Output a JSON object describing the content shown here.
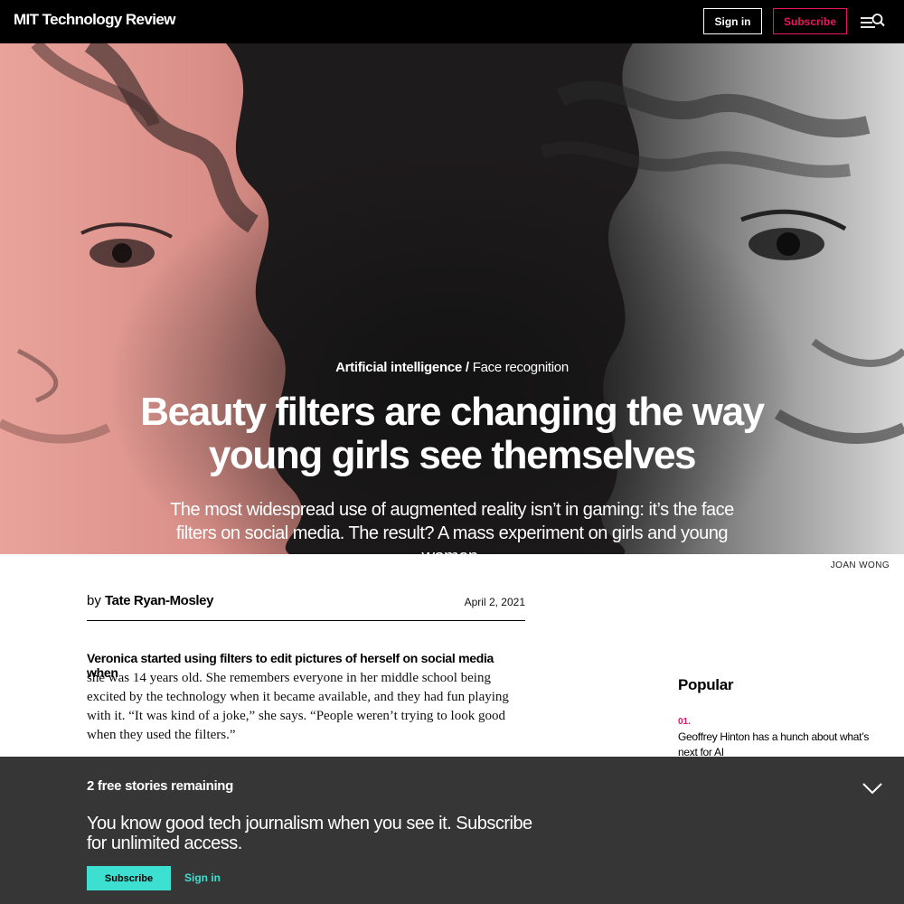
{
  "header": {
    "logo": "MIT Technology Review",
    "signin_label": "Sign in",
    "subscribe_label": "Subscribe",
    "menu_icon": "menu-search-icon"
  },
  "hero": {
    "category": "Artificial intelligence",
    "separator": "/",
    "subcategory": "Face recognition",
    "headline": "Beauty filters are changing the way young girls see themselves",
    "dek": "The most widespread use of augmented reality isn’t in gaming: it’s the face filters on social media. The result? A mass experiment on girls and young women.",
    "image_credit": "JOAN WONG"
  },
  "article": {
    "byline_prefix": "by",
    "author": "Tate Ryan-Mosley",
    "date": "April 2, 2021",
    "lead": "Veronica started using filters to edit pictures of herself on social media when",
    "body": "she was 14 years old. She remembers everyone in her middle school being excited by the technology when it became available, and they had fun playing with it. “It was kind of a joke,” she says. “People weren’t trying to look good when they used the filters.”"
  },
  "sidebar": {
    "title": "Popular",
    "items": [
      {
        "number": "01.",
        "text": "Geoffrey Hinton has a hunch about what’s next for AI"
      }
    ]
  },
  "paywall": {
    "count_text": "2 free stories remaining",
    "message": "You know good tech journalism when you see it. Subscribe for unlimited access.",
    "subscribe_label": "Subscribe",
    "signin_label": "Sign in"
  },
  "colors": {
    "accent_pink": "#e5175f",
    "accent_teal": "#3de0d0",
    "paywall_bg": "#363636",
    "hero_pink": "#e8a29a"
  }
}
